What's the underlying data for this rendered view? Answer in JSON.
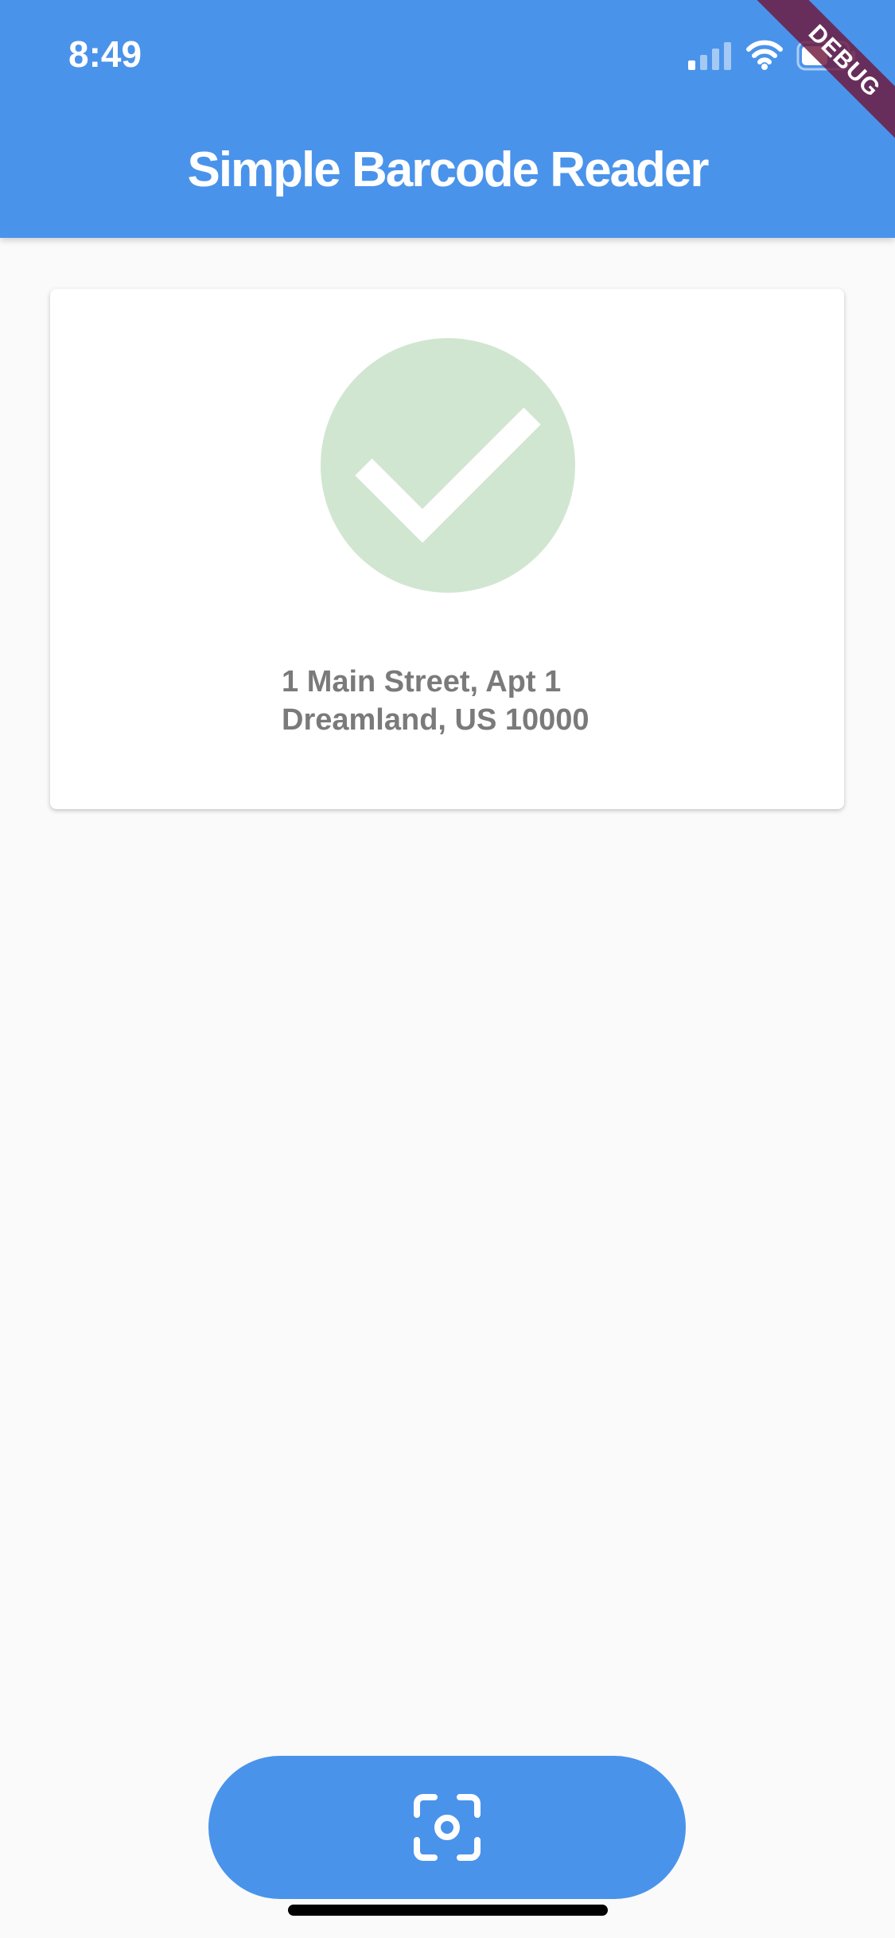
{
  "status_bar": {
    "time": "8:49",
    "icons": [
      "cellular-signal-icon",
      "wifi-icon",
      "battery-icon"
    ]
  },
  "debug_banner": {
    "label": "DEBUG",
    "color": "#6e193c"
  },
  "app_bar": {
    "title": "Simple Barcode Reader",
    "color": "#4a93eb"
  },
  "result_card": {
    "status_icon": "check-circle-icon",
    "status_color": "#d1e6d0",
    "address_line_1": "1 Main Street, Apt 1",
    "address_line_2": "Dreamland, US 10000"
  },
  "scan_button": {
    "icon": "camera-scan-icon",
    "color": "#4a93eb"
  }
}
